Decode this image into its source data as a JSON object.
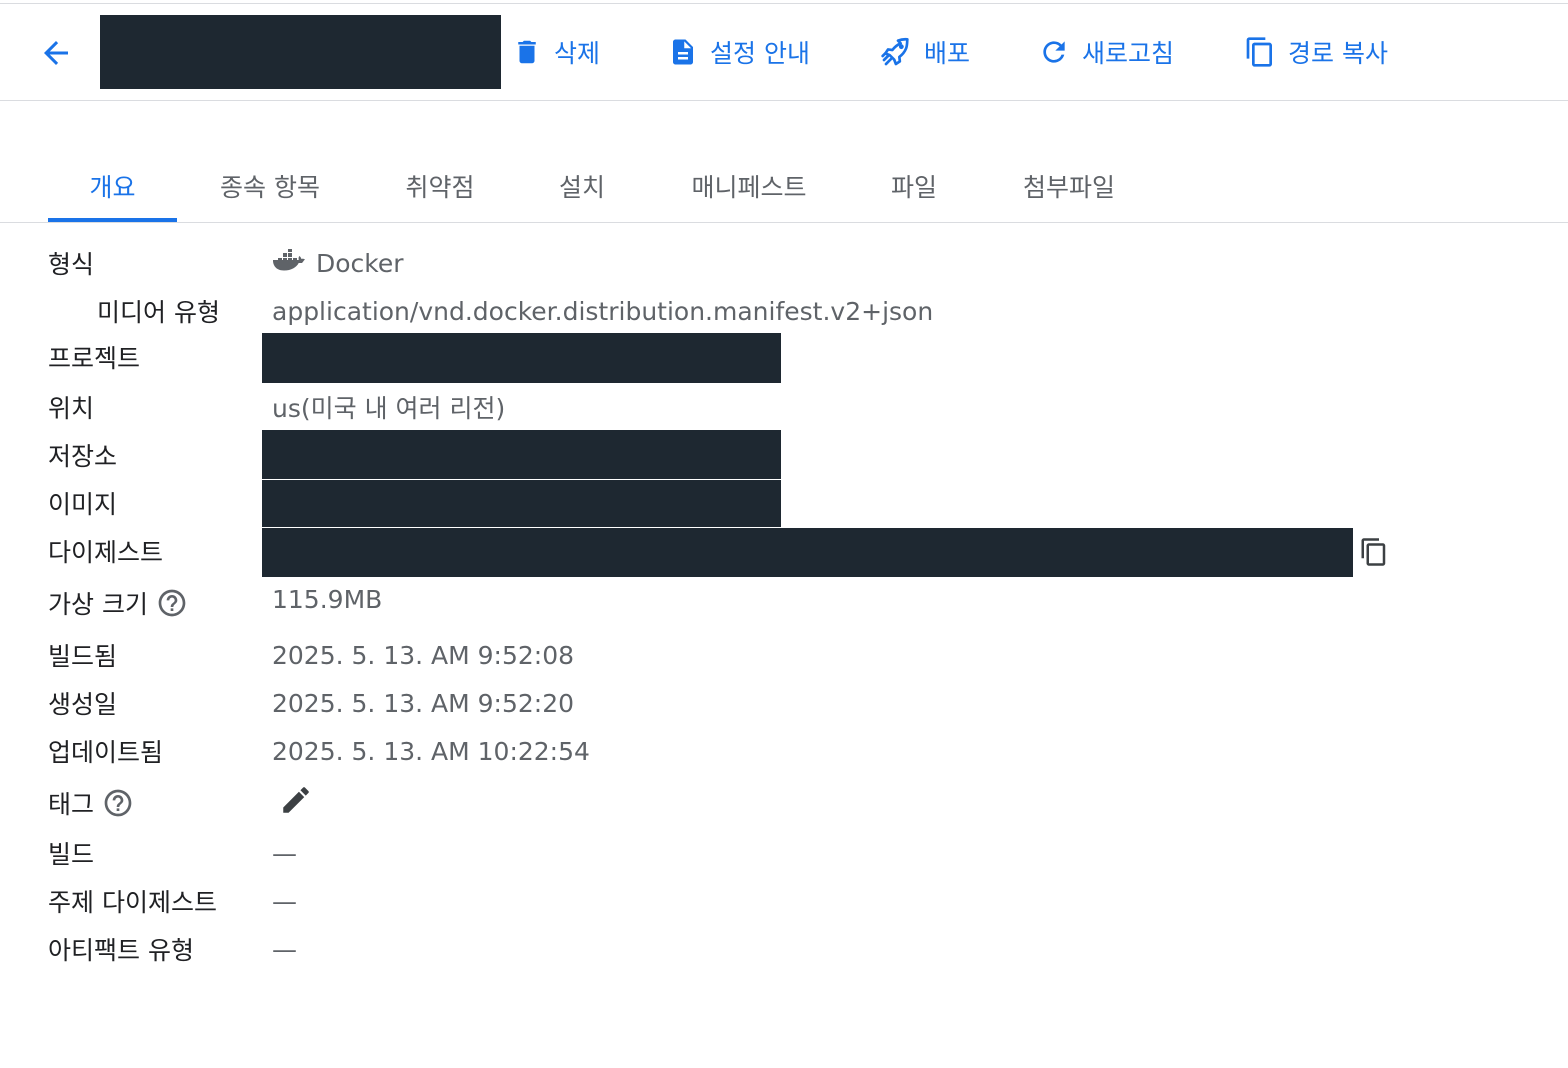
{
  "toolbar": {
    "back_label": "",
    "delete": "삭제",
    "setup": "설정 안내",
    "deploy": "배포",
    "refresh": "새로고침",
    "copy_path": "경로 복사"
  },
  "tabs": [
    "개요",
    "종속 항목",
    "취약점",
    "설치",
    "매니페스트",
    "파일",
    "첨부파일"
  ],
  "active_tab": "개요",
  "details": {
    "format_label": "형식",
    "format_value": "Docker",
    "media_type_label": "미디어 유형",
    "media_type_value": "application/vnd.docker.distribution.manifest.v2+json",
    "project_label": "프로젝트",
    "location_label": "위치",
    "location_value": "us(미국 내 여러 리전)",
    "repository_label": "저장소",
    "image_label": "이미지",
    "digest_label": "다이제스트",
    "virtual_size_label": "가상 크기",
    "virtual_size_value": "115.9MB",
    "built_label": "빌드됨",
    "built_value": "2025. 5. 13. AM 9:52:08",
    "created_label": "생성일",
    "created_value": "2025. 5. 13. AM 9:52:20",
    "updated_label": "업데이트됨",
    "updated_value": "2025. 5. 13. AM 10:22:54",
    "tags_label": "태그",
    "build_label": "빌드",
    "build_value": "—",
    "subject_digest_label": "주제 다이제스트",
    "subject_digest_value": "—",
    "artifact_type_label": "아티팩트 유형",
    "artifact_type_value": "—"
  },
  "colors": {
    "accent": "#1a73e8",
    "redaction": "#1e2831",
    "text_secondary": "#5f6368",
    "divider": "#dadce0"
  },
  "icons": {
    "back": "arrow-left-icon",
    "delete": "trash-icon",
    "setup": "document-icon",
    "deploy": "rocket-icon",
    "refresh": "refresh-icon",
    "copy": "copy-icon",
    "format": "docker-whale-icon",
    "help": "help-circle-icon",
    "edit": "pencil-icon"
  }
}
